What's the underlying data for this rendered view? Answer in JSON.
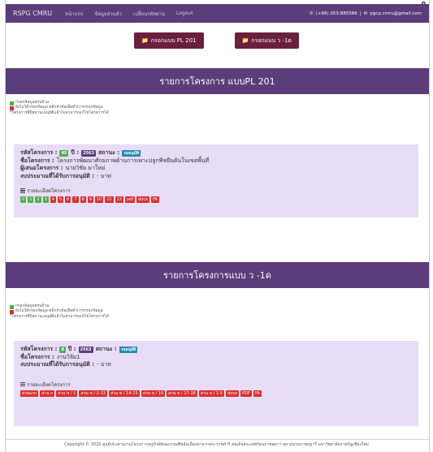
{
  "corner_text": "ฏ",
  "navbar": {
    "brand": "RSPG CMRU",
    "links": [
      "หน้าแรก",
      "ข้อมูลส่วนตัว",
      "เปลี่ยนรหัสผ่าน",
      "Logout"
    ],
    "phone": "(+66) 053-885586",
    "email": "pgcp.cmru@gmail.com",
    "phone_icon": "phone-icon",
    "mail_icon": "envelope-icon"
  },
  "top_buttons": [
    {
      "label": "กรอกแบบ PL 201",
      "icon": "folder-icon"
    },
    {
      "label": "กรอกแบบ ว -1ด",
      "icon": "folder-icon"
    }
  ],
  "sections": [
    {
      "title": "รายการโครงการ แบบPL 201",
      "legend": {
        "complete": "กรอกข้อมูลครบถ้วน",
        "incomplete": "ยังไม่ได้กรอกข้อมูล คลิกหัวข้อเพื่อทำการกรอกข้อมูล",
        "note": "*โครงการที่มีสถานะอนุมัติแล้วไม่สามารถแก้ไขโครงการได้"
      },
      "project": {
        "code_label": "รหัสโครงการ :",
        "code_value": "45",
        "year_label": "ปี :",
        "year_value": "2563",
        "status_label": "สถานะ :",
        "status_value": "รออนุมัติ",
        "name_label": "ชื่อโครงการ :",
        "name_value": "โครงการพัฒนาศักยภาพด้านการเพาะปลูกพืชยืนต้นในเขตพื้นที่",
        "proposer_label": "ผู้เสนอโครงการ :",
        "proposer_value": "นายวิชัย มาใหม่",
        "budget_label": "งบประมาณที่ได้รับการอนุมัติ :",
        "budget_value": "- บาท",
        "details_label": "รายละเอียดโครงการ",
        "items": [
          {
            "label": "0",
            "status": "complete"
          },
          {
            "label": "1",
            "status": "complete"
          },
          {
            "label": "2",
            "status": "complete"
          },
          {
            "label": "3",
            "status": "complete"
          },
          {
            "label": "4",
            "status": "incomplete"
          },
          {
            "label": "5",
            "status": "incomplete"
          },
          {
            "label": "6",
            "status": "incomplete"
          },
          {
            "label": "7",
            "status": "incomplete"
          },
          {
            "label": "8",
            "status": "incomplete"
          },
          {
            "label": "9",
            "status": "incomplete"
          },
          {
            "label": "10",
            "status": "incomplete"
          },
          {
            "label": "11",
            "status": "incomplete"
          },
          {
            "label": "12",
            "status": "incomplete"
          },
          {
            "label": "pdf",
            "status": "incomplete"
          },
          {
            "label": "docx",
            "status": "incomplete"
          },
          {
            "label": "FA",
            "status": "incomplete"
          }
        ]
      }
    },
    {
      "title": "รายการโครงการแบบ ว -1ด",
      "legend": {
        "complete": "กรอกข้อมูลครบถ้วน",
        "incomplete": "ยังไม่ได้กรอกข้อมูล คลิกหัวข้อเพื่อทำการกรอกข้อมูล",
        "note": "*โครงการที่มีสถานะอนุมัติแล้วไม่สามารถแก้ไขโครงการได้"
      },
      "project": {
        "code_label": "รหัสโครงการ :",
        "code_value": "8",
        "year_label": "ปี :",
        "year_value": "2563",
        "status_label": "สถานะ :",
        "status_value": "รออนุมัติ",
        "name_label": "ชื่อโครงการ :",
        "name_value": "งานวิจัย1",
        "budget_label": "งบประมาณที่ได้รับการอนุมัติ :",
        "budget_value": "- บาท",
        "details_label": "รายละเอียดโครงการ",
        "items": [
          {
            "label": "ส่วนแรก",
            "status": "incomplete"
          },
          {
            "label": "ส่วน ก",
            "status": "incomplete"
          },
          {
            "label": "ส่วน ข / 1",
            "status": "incomplete"
          },
          {
            "label": "ส่วน ข / 2-13",
            "status": "incomplete"
          },
          {
            "label": "ส่วน ข / 14-15",
            "status": "incomplete"
          },
          {
            "label": "ส่วน ข / 16",
            "status": "incomplete"
          },
          {
            "label": "ส่วน ข / 17-18",
            "status": "incomplete"
          },
          {
            "label": "ส่วน ค / 1-5",
            "status": "incomplete"
          },
          {
            "label": "docx",
            "status": "incomplete"
          },
          {
            "label": "PDF",
            "status": "incomplete"
          },
          {
            "label": "FA",
            "status": "incomplete"
          }
        ]
      }
    }
  ],
  "footer": "Copyright © 2020 ศูนย์ประสานงานโครงการอนุรักษ์พันธุกรรมพืชอันเนื่องมาจากพระราชดำริ สมเด็จพระเทพรัตนราชสุดาฯ สยามบรมราชกุมารี มหาวิทยาลัยราชภัฏเชียงใหม่",
  "colors": {
    "header": "#5a3d7a",
    "button": "#6a1f3f",
    "panel": "#e9dcf6",
    "complete": "#4caf50",
    "incomplete": "#d9302d",
    "status": "#1e8bb5"
  }
}
